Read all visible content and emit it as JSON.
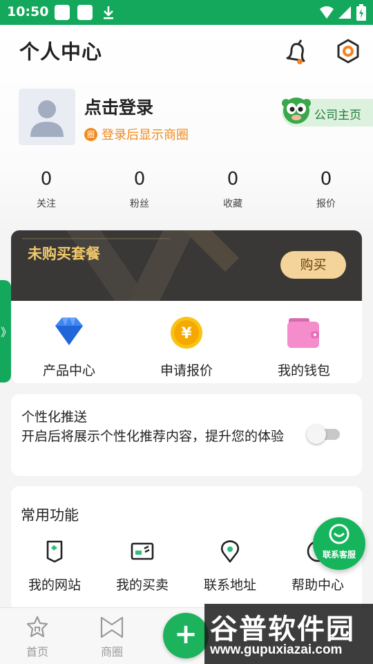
{
  "status_bar": {
    "time": "10:50"
  },
  "header": {
    "title": "个人中心",
    "icons": [
      "bell-icon",
      "settings-icon"
    ]
  },
  "profile": {
    "login_title": "点击登录",
    "login_sub_badge": "圈",
    "login_sub": "登录后显示商圈",
    "company_link": "公司主页"
  },
  "stats": [
    {
      "value": "0",
      "label": "关注"
    },
    {
      "value": "0",
      "label": "粉丝"
    },
    {
      "value": "0",
      "label": "收藏"
    },
    {
      "value": "0",
      "label": "报价"
    }
  ],
  "package": {
    "title": "未购买套餐",
    "buy_label": "购买",
    "services": [
      {
        "label": "产品中心",
        "icon": "diamond-icon"
      },
      {
        "label": "申请报价",
        "icon": "yen-coin-icon"
      },
      {
        "label": "我的钱包",
        "icon": "wallet-icon"
      }
    ]
  },
  "side_tab": {
    "label": "》"
  },
  "personalize": {
    "title": "个性化推送",
    "desc": "开启后将展示个性化推荐内容，提升您的体验",
    "enabled": false
  },
  "functions": {
    "title": "常用功能",
    "items": [
      {
        "label": "我的网站",
        "icon": "website-icon"
      },
      {
        "label": "我的买卖",
        "icon": "trade-icon"
      },
      {
        "label": "联系地址",
        "icon": "location-icon"
      },
      {
        "label": "帮助中心",
        "icon": "help-icon"
      }
    ]
  },
  "customer_service": {
    "label": "联系客服"
  },
  "bottom_nav": {
    "items": [
      {
        "label": "首页",
        "icon": "home-icon"
      },
      {
        "label": "商圈",
        "icon": "circle-icon"
      }
    ],
    "add_label": "+"
  },
  "watermark": {
    "text": "谷普软件园",
    "url": "www.gupuxiazai.com"
  },
  "colors": {
    "brand_green": "#14a85c",
    "accent_orange": "#f08a1c",
    "banner_gold": "#f2c96a"
  }
}
